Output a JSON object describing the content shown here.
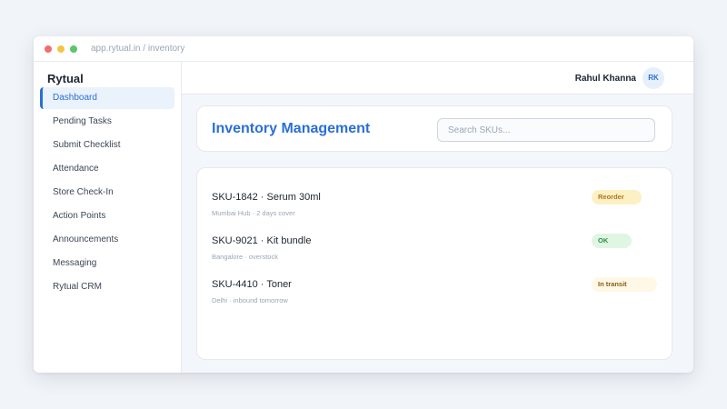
{
  "browser": {
    "url": "app.rytual.in / inventory"
  },
  "sidebar": {
    "brand": "Rytual",
    "items": [
      {
        "label": "Dashboard",
        "active": true
      },
      {
        "label": "Pending Tasks"
      },
      {
        "label": "Submit Checklist"
      },
      {
        "label": "Attendance"
      },
      {
        "label": "Store Check-In"
      },
      {
        "label": "Action Points"
      },
      {
        "label": "Announcements"
      },
      {
        "label": "Messaging"
      },
      {
        "label": "Rytual CRM"
      }
    ]
  },
  "topbar": {
    "user_name": "Rahul Khanna",
    "avatar_initials": "RK"
  },
  "main": {
    "title": "Inventory Management",
    "search_placeholder": "Search SKUs...",
    "rows": [
      {
        "title": "SKU-1842 · Serum 30ml",
        "subtitle": "Mumbai Hub · 2 days cover",
        "status": "Reorder"
      },
      {
        "title": "SKU-9021 · Kit bundle",
        "subtitle": "Bangalore · overstock",
        "status": "OK"
      },
      {
        "title": "SKU-4410 · Toner",
        "subtitle": "Delhi · inbound tomorrow",
        "status": "In transit"
      }
    ]
  },
  "colors": {
    "accent": "#2a6fd6",
    "reorder_bg": "#fdf0c4",
    "ok_bg": "#dff6e3",
    "transit_bg": "#fff8e6"
  }
}
